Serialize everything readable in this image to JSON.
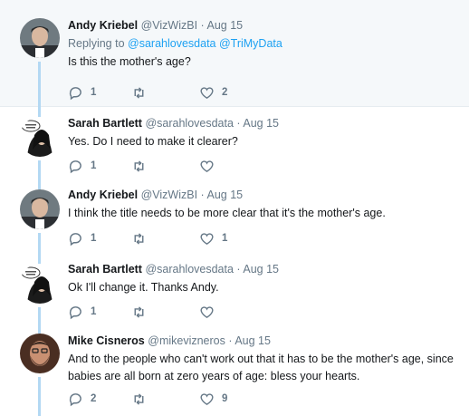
{
  "tweets": [
    {
      "name": "Andy Kriebel",
      "handle": "@VizWizBI",
      "separator": "·",
      "date": "Aug 15",
      "reply_prefix": "Replying to",
      "reply_mentions": "@sarahlovesdata @TriMyData",
      "text": "Is this the mother's age?",
      "reply_count": "1",
      "retweet_count": "",
      "like_count": "2",
      "avatar_icon": "man-portrait-avatar"
    },
    {
      "name": "Sarah Bartlett",
      "handle": "@sarahlovesdata",
      "separator": "·",
      "date": "Aug 15",
      "text": "Yes. Do I need to make it clearer?",
      "reply_count": "1",
      "retweet_count": "",
      "like_count": "",
      "avatar_icon": "woman-speech-bubble-avatar"
    },
    {
      "name": "Andy Kriebel",
      "handle": "@VizWizBI",
      "separator": "·",
      "date": "Aug 15",
      "text": "I think the title needs to be more clear that it's the mother's age.",
      "reply_count": "1",
      "retweet_count": "",
      "like_count": "1",
      "avatar_icon": "man-portrait-avatar"
    },
    {
      "name": "Sarah Bartlett",
      "handle": "@sarahlovesdata",
      "separator": "·",
      "date": "Aug 15",
      "text": "Ok I'll change it. Thanks Andy.",
      "reply_count": "1",
      "retweet_count": "",
      "like_count": "",
      "avatar_icon": "woman-speech-bubble-avatar"
    },
    {
      "name": "Mike Cisneros",
      "handle": "@mikevizneros",
      "separator": "·",
      "date": "Aug 15",
      "text": "And to the people who can't work out that it has to be the mother's age, since babies are all born at zero years of age: bless your hearts.",
      "reply_count": "2",
      "retweet_count": "",
      "like_count": "9",
      "avatar_icon": "bearded-man-avatar"
    }
  ],
  "colors": {
    "link": "#1da1f2",
    "muted": "#657786",
    "thread_line": "#b3d8f3",
    "highlight_bg": "#f5f8fa"
  }
}
